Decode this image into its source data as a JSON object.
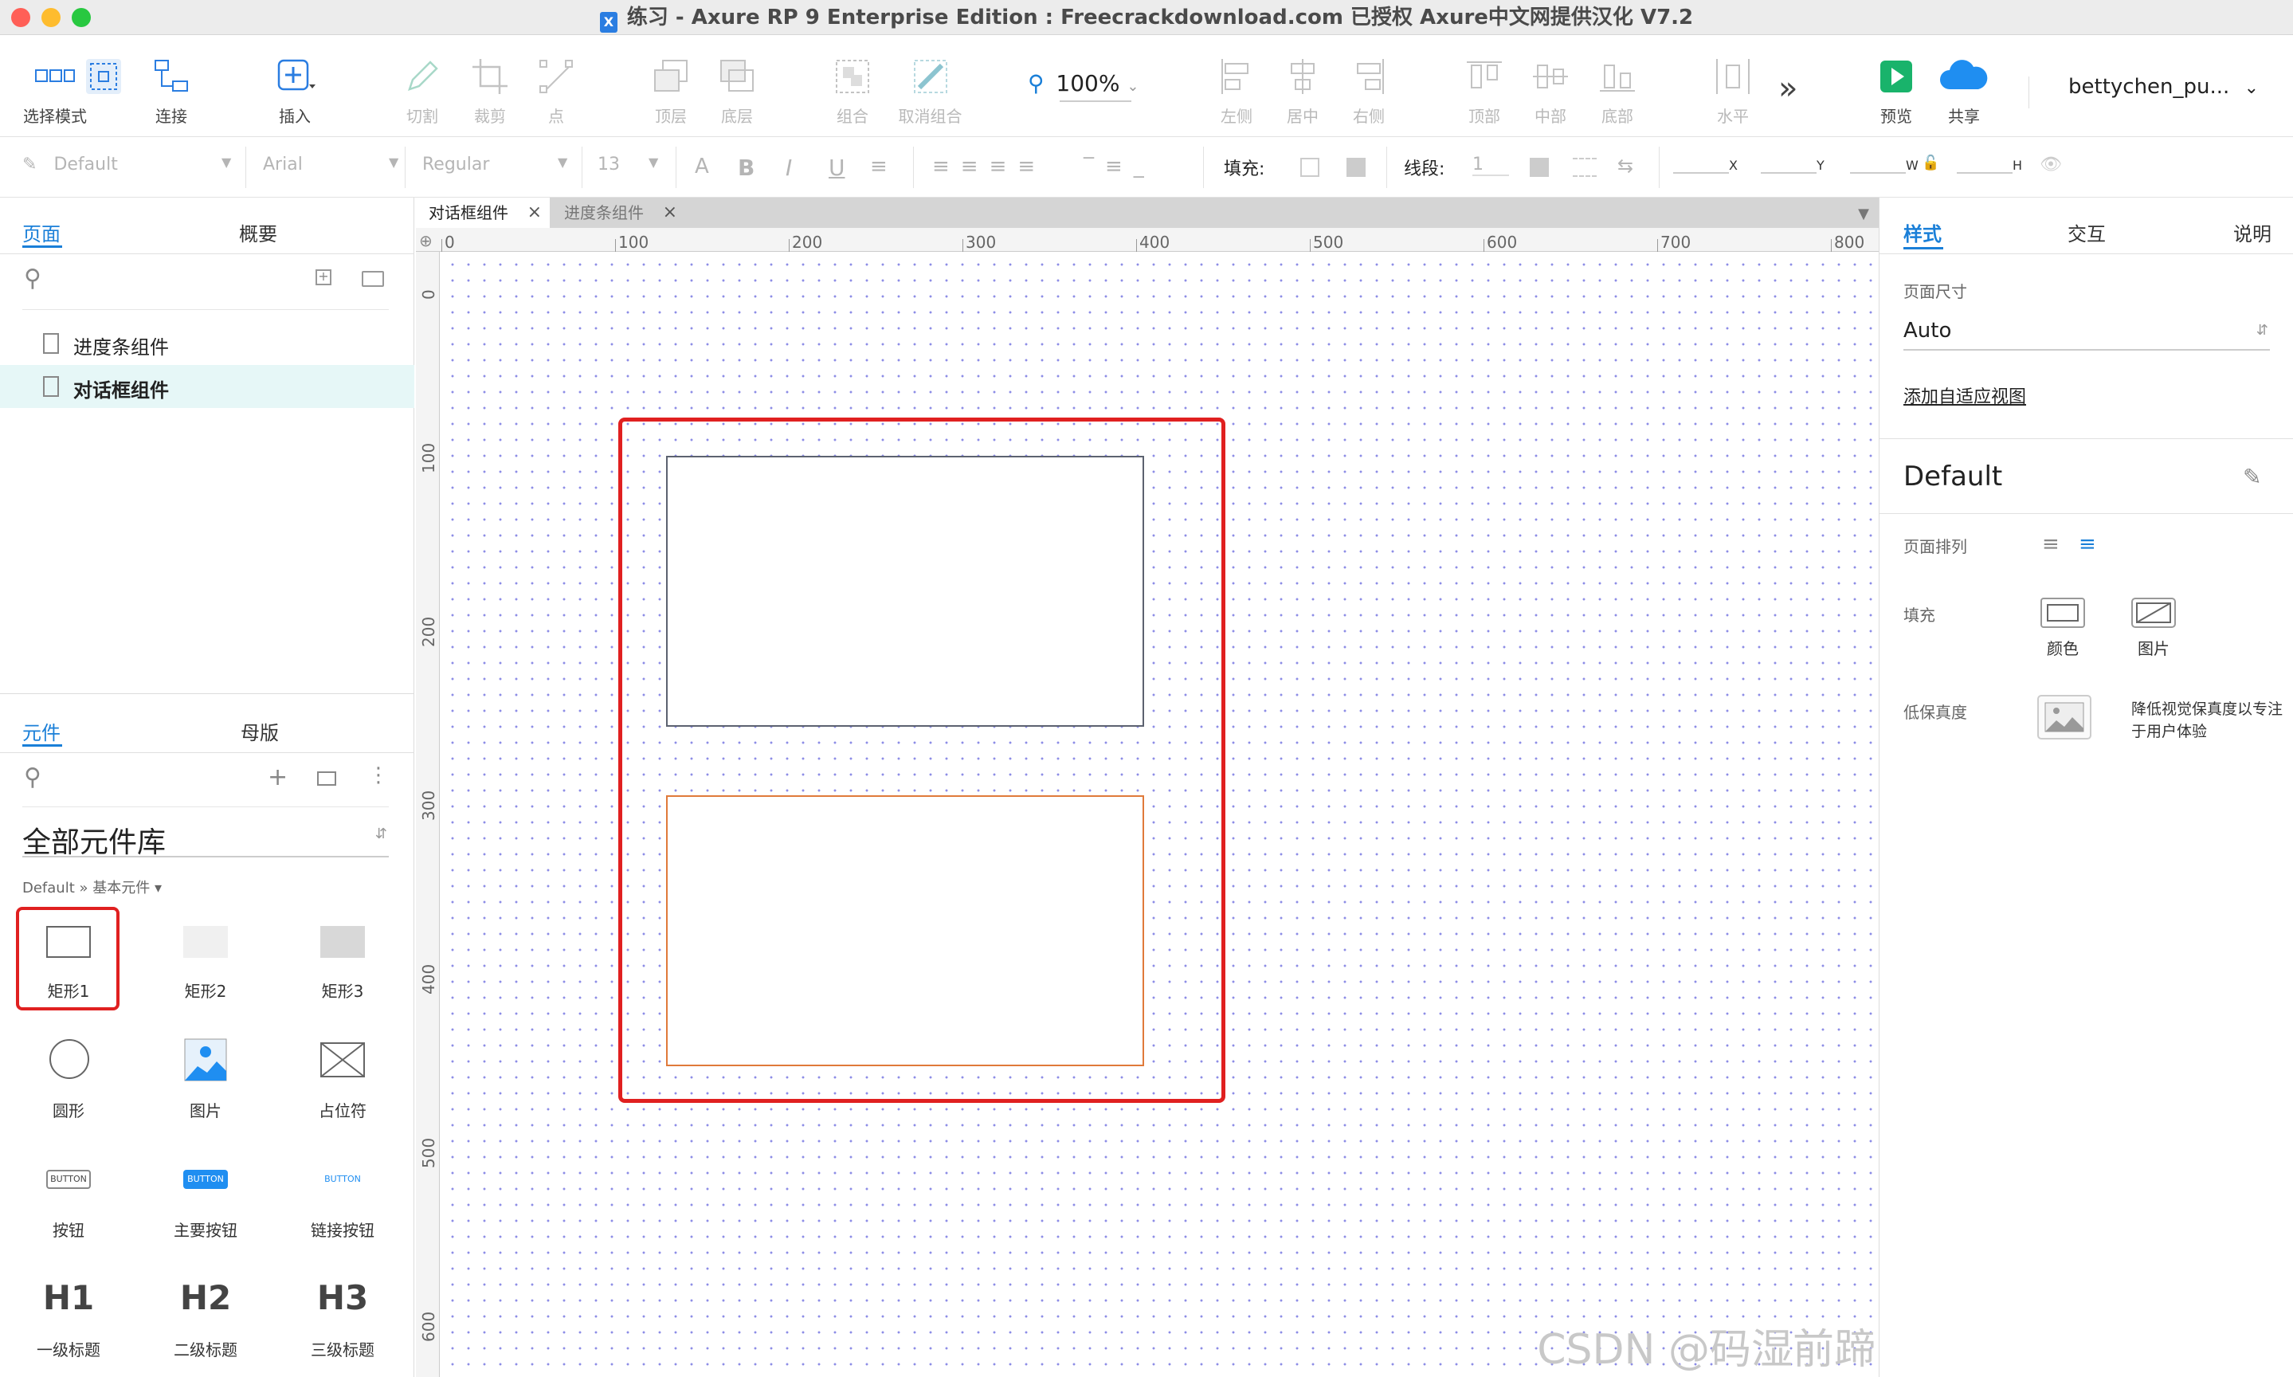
{
  "window": {
    "title": "练习 - Axure RP 9 Enterprise Edition : Freecrackdownload.com 已授权    Axure中文网提供汉化 V7.2",
    "app_badge": "X"
  },
  "toolbar": {
    "select_mode": "选择模式",
    "connect": "连接",
    "insert": "插入",
    "cut": "切割",
    "crop": "裁剪",
    "point": "点",
    "top": "顶层",
    "bottom": "底层",
    "group": "组合",
    "ungroup": "取消组合",
    "zoom": "100%",
    "align_left": "左侧",
    "align_center": "居中",
    "align_right": "右侧",
    "align_top": "顶部",
    "align_middle": "中部",
    "align_bottom": "底部",
    "distribute_h": "水平",
    "more": "»",
    "preview": "预览",
    "share": "共享",
    "user": "bettychen_pu..."
  },
  "formatbar": {
    "style": "Default",
    "font": "Arial",
    "weight": "Regular",
    "size": "13",
    "fill_label": "填充:",
    "stroke_label": "线段:",
    "stroke_value": "1",
    "x_label": "X",
    "y_label": "Y",
    "w_label": "W",
    "h_label": "H"
  },
  "left_panel": {
    "pages_tab": "页面",
    "outline_tab": "概要",
    "pages": [
      "进度条组件",
      "对话框组件"
    ],
    "selected_page_index": 1,
    "widgets_tab": "元件",
    "masters_tab": "母版",
    "library_title": "全部元件库",
    "library_path": "Default » 基本元件",
    "widgets": [
      {
        "label": "矩形1",
        "icon": "rectangle-outline-icon"
      },
      {
        "label": "矩形2",
        "icon": "rectangle-light-icon"
      },
      {
        "label": "矩形3",
        "icon": "rectangle-gray-icon"
      },
      {
        "label": "圆形",
        "icon": "circle-icon"
      },
      {
        "label": "图片",
        "icon": "image-icon"
      },
      {
        "label": "占位符",
        "icon": "placeholder-icon"
      },
      {
        "label": "按钮",
        "icon": "button-icon",
        "sample": "BUTTON"
      },
      {
        "label": "主要按钮",
        "icon": "primary-button-icon",
        "sample": "BUTTON"
      },
      {
        "label": "链接按钮",
        "icon": "link-button-icon",
        "sample": "BUTTON"
      },
      {
        "label": "一级标题",
        "icon": "h1-icon",
        "sample": "H1"
      },
      {
        "label": "二级标题",
        "icon": "h2-icon",
        "sample": "H2"
      },
      {
        "label": "三级标题",
        "icon": "h3-icon",
        "sample": "H3"
      }
    ]
  },
  "canvas": {
    "tabs": [
      "对话框组件",
      "进度条组件"
    ],
    "active_tab_index": 0,
    "ruler_h": [
      "0",
      "100",
      "200",
      "300",
      "400",
      "500",
      "600",
      "700",
      "800"
    ],
    "ruler_v": [
      "0",
      "100",
      "200",
      "300",
      "400",
      "500",
      "600"
    ]
  },
  "right_panel": {
    "style_tab": "样式",
    "interaction_tab": "交互",
    "notes_tab": "说明",
    "page_size_label": "页面尺寸",
    "page_size_value": "Auto",
    "adaptive_link": "添加自适应视图",
    "style_name": "Default",
    "page_align_label": "页面排列",
    "fill_label": "填充",
    "fill_color": "颜色",
    "fill_image": "图片",
    "low_fidelity_label": "低保真度",
    "low_fidelity_desc": "降低视觉保真度以专注于用户体验"
  },
  "watermark": "CSDN @码湿前蹄",
  "colors": {
    "accent": "#1a7fd8",
    "highlight_red": "#e02020",
    "orange_stroke": "#e07a3a",
    "preview_green": "#19b36b"
  }
}
